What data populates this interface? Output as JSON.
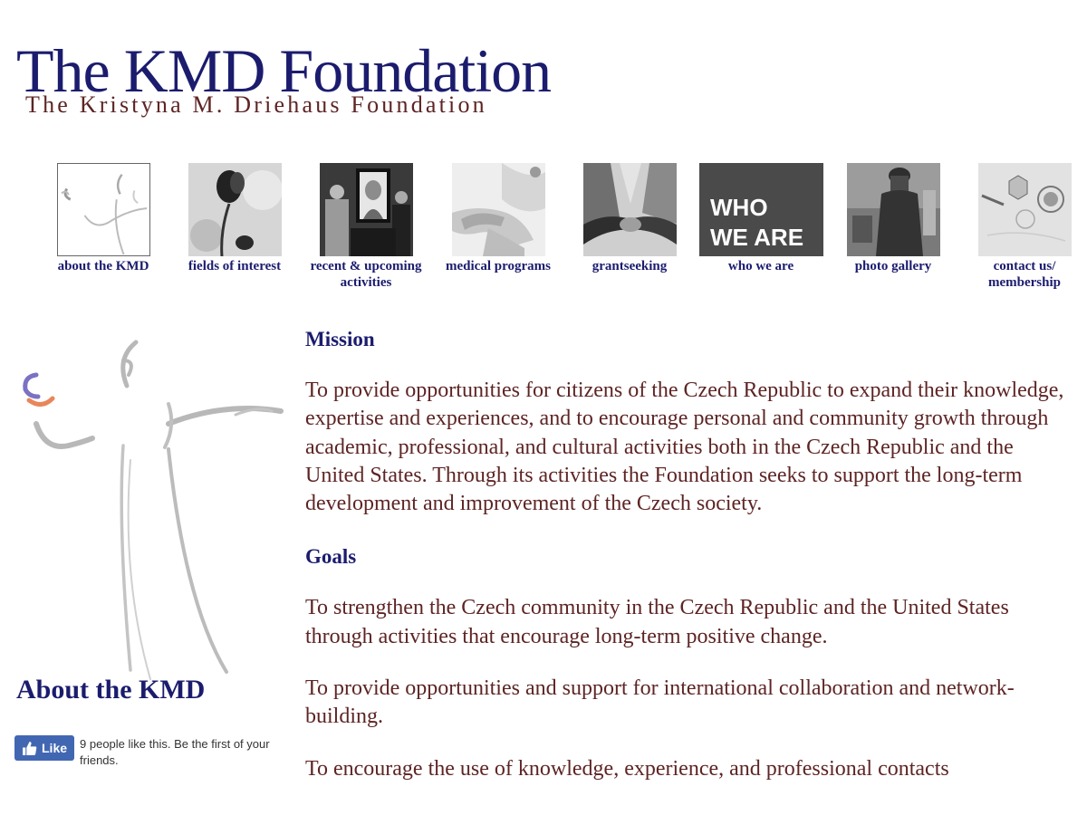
{
  "header": {
    "title": "The KMD Foundation",
    "subtitle": "The Kristyna M. Driehaus Foundation"
  },
  "nav": [
    {
      "label": "about the KMD",
      "icon": "kmd-figure-thumbnail"
    },
    {
      "label": "fields of interest",
      "icon": "flower-photo-thumbnail"
    },
    {
      "label": "recent & upcoming activities",
      "icon": "event-portrait-photo-thumbnail"
    },
    {
      "label": "medical programs",
      "icon": "hands-photo-thumbnail"
    },
    {
      "label": "grantseeking",
      "icon": "handshake-photo-thumbnail"
    },
    {
      "label": "who we are",
      "icon": "who-we-are-thumbnail",
      "thumb_text": "WHO WE ARE"
    },
    {
      "label": "photo gallery",
      "icon": "statue-photo-thumbnail"
    },
    {
      "label": "contact us/ membership",
      "icon": "stamped-envelope-thumbnail"
    }
  ],
  "sidebar": {
    "heading": "About the KMD",
    "like_button_label": "Like",
    "like_text": "9 people like this. Be the first of your friends."
  },
  "content": {
    "mission_heading": "Mission",
    "mission_text": "To provide opportunities for citizens of the Czech Republic to expand their knowledge, expertise and experiences, and to encourage personal and community growth through academic, professional, and cultural activities both in the Czech Republic and the United States. Through its activities the Foundation seeks to support the long-term development and improvement of the Czech society.",
    "goals_heading": "Goals",
    "goals": [
      "To strengthen the Czech community in the Czech Republic and the United States through activities that encourage long-term positive change.",
      "To provide opportunities and support for international collaboration and network-building.",
      "To encourage the use of knowledge, experience, and professional contacts"
    ]
  },
  "colors": {
    "title": "#1b1c6e",
    "body_text": "#5e2424",
    "facebook": "#4267b2",
    "logo_purple": "#7b72c4",
    "logo_orange": "#e8865a"
  }
}
